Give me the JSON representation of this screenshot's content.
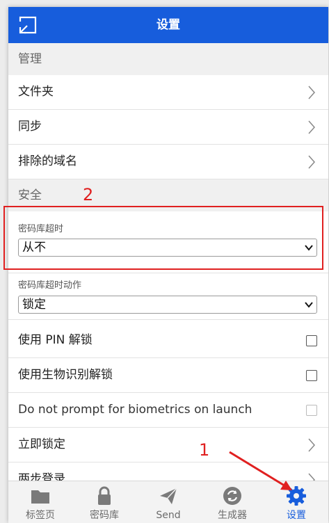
{
  "header": {
    "title": "设置"
  },
  "sections": {
    "manage": {
      "label": "管理"
    },
    "security": {
      "label": "安全"
    }
  },
  "manage_items": [
    "文件夹",
    "同步",
    "排除的域名"
  ],
  "vault_timeout": {
    "label": "密码库超时",
    "value": "从不"
  },
  "vault_timeout_action": {
    "label": "密码库超时动作",
    "value": "锁定"
  },
  "security_items": {
    "unlock_pin": "使用 PIN 解锁",
    "unlock_bio": "使用生物识别解锁",
    "no_bio_prompt": "Do not prompt for biometrics on launch",
    "lock_now": "立即锁定",
    "two_step": "两步登录"
  },
  "annotations": {
    "num1": "1",
    "num2": "2",
    "color": "#e02020"
  },
  "nav": [
    {
      "label": "标签页",
      "icon": "folder-icon"
    },
    {
      "label": "密码库",
      "icon": "lock-icon"
    },
    {
      "label": "Send",
      "icon": "send-icon"
    },
    {
      "label": "生成器",
      "icon": "refresh-icon"
    },
    {
      "label": "设置",
      "icon": "gear-icon",
      "active": true
    }
  ],
  "colors": {
    "accent": "#175ddc",
    "annotation": "#e02020"
  }
}
